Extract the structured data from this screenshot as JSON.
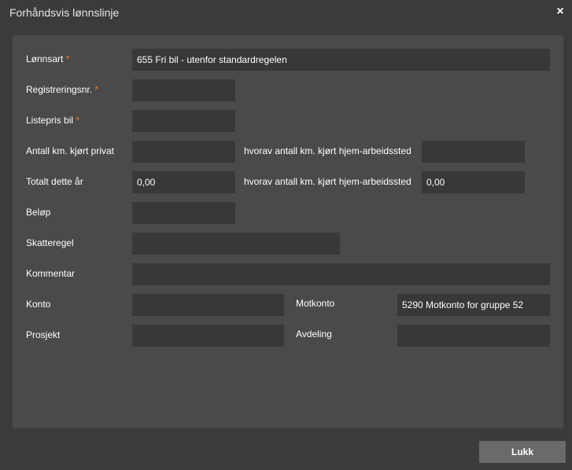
{
  "dialog": {
    "title": "Forhåndsvis lønnslinje",
    "close_icon": "×",
    "close_button": "Lukk"
  },
  "form": {
    "required_mark": "*",
    "lonnsart": {
      "label": "Lønnsart",
      "value": "655 Fri bil - utenfor standardregelen"
    },
    "registreringsnr": {
      "label": "Registreringsnr.",
      "value": ""
    },
    "listepris": {
      "label": "Listepris bil",
      "value": ""
    },
    "antall_km": {
      "label": "Antall km. kjørt privat",
      "value": ""
    },
    "hvorav_1": {
      "label": "hvorav antall km. kjørt hjem-arbeidssted",
      "value": ""
    },
    "totalt": {
      "label": "Totalt dette år",
      "value": "0,00"
    },
    "hvorav_2": {
      "label": "hvorav antall km. kjørt hjem-arbeidssted",
      "value": "0,00"
    },
    "belop": {
      "label": "Beløp",
      "value": ""
    },
    "skatteregel": {
      "label": "Skatteregel",
      "value": ""
    },
    "kommentar": {
      "label": "Kommentar",
      "value": ""
    },
    "konto": {
      "label": "Konto",
      "value": ""
    },
    "motkonto": {
      "label": "Motkonto",
      "value": "5290 Motkonto for gruppe 52"
    },
    "prosjekt": {
      "label": "Prosjekt",
      "value": ""
    },
    "avdeling": {
      "label": "Avdeling",
      "value": ""
    }
  },
  "colors": {
    "background": "#3b3b3b",
    "panel": "#4a4a4a",
    "field": "#383838",
    "required": "#e8792f",
    "button": "#6a6a6a"
  }
}
